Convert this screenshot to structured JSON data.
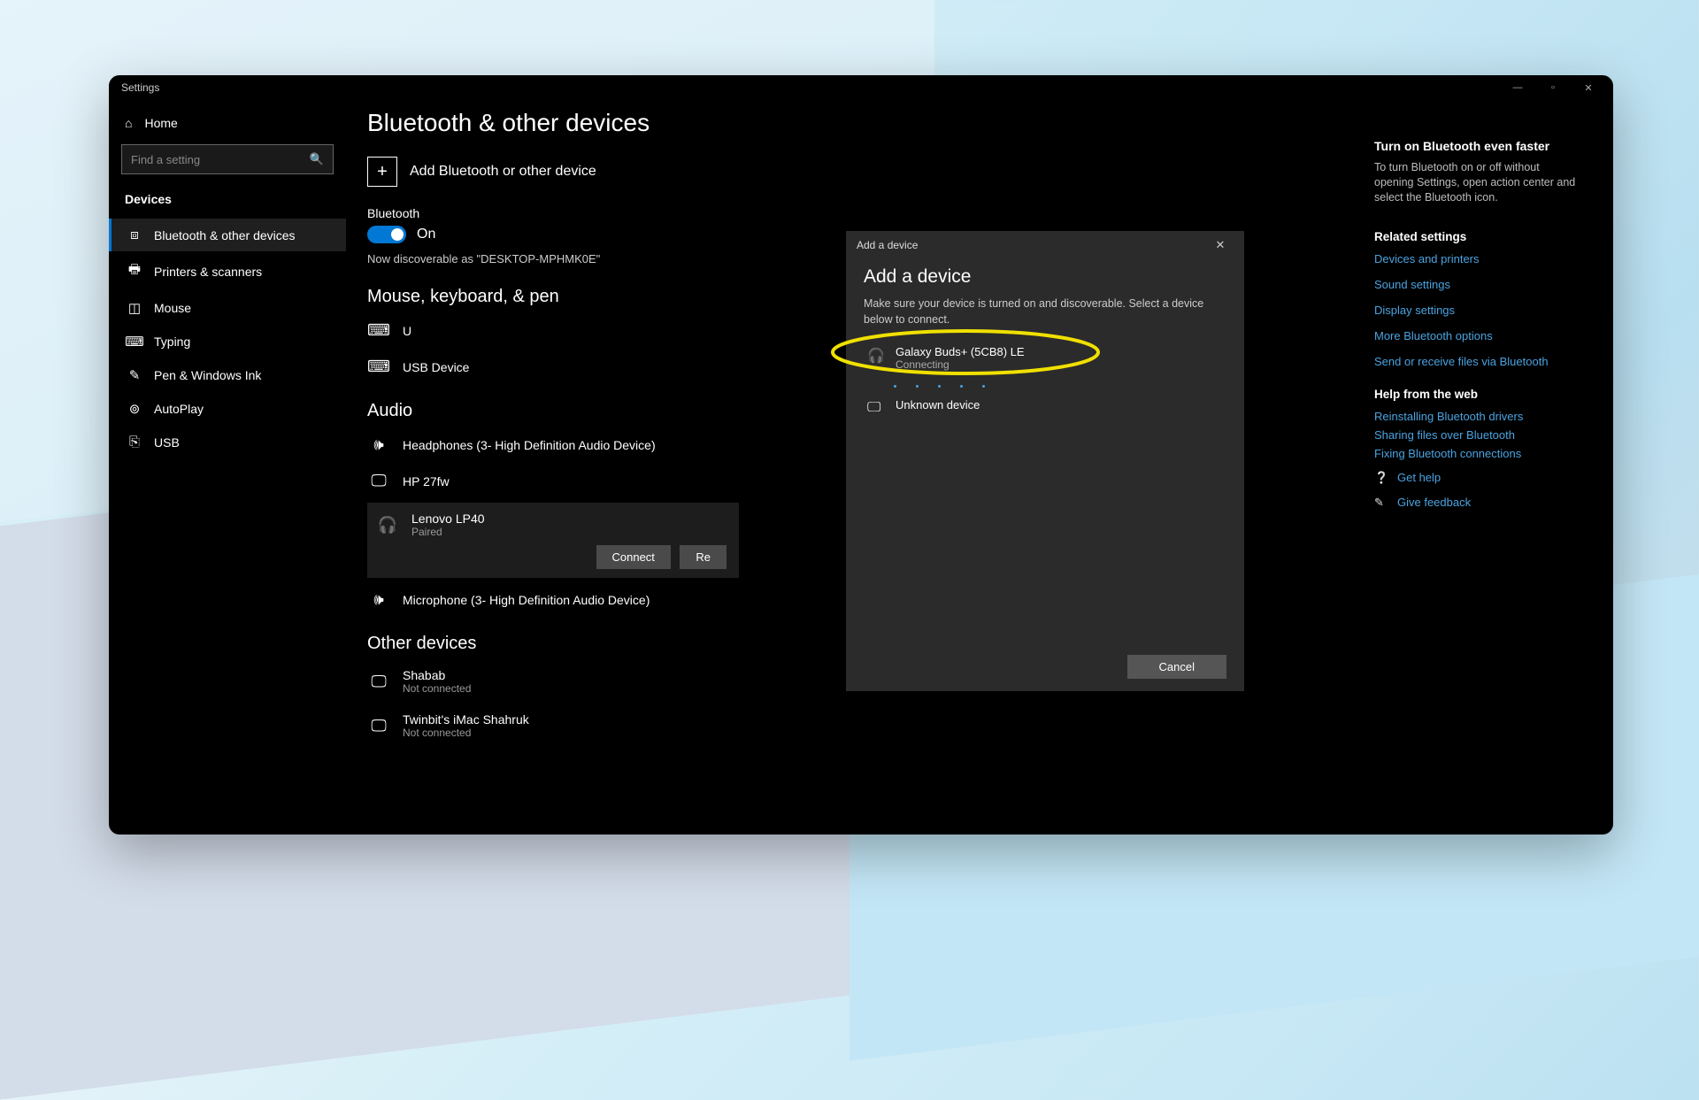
{
  "window": {
    "title": "Settings"
  },
  "winbtns": {
    "min": "—",
    "max": "▫",
    "close": "✕"
  },
  "sidebar": {
    "home": "Home",
    "search_placeholder": "Find a setting",
    "header": "Devices",
    "items": [
      {
        "label": "Bluetooth & other devices",
        "icon": "⧈"
      },
      {
        "label": "Printers & scanners",
        "icon": "🖶"
      },
      {
        "label": "Mouse",
        "icon": "◫"
      },
      {
        "label": "Typing",
        "icon": "⌨"
      },
      {
        "label": "Pen & Windows Ink",
        "icon": "✎"
      },
      {
        "label": "AutoPlay",
        "icon": "⊚"
      },
      {
        "label": "USB",
        "icon": "⎘"
      }
    ]
  },
  "main": {
    "heading": "Bluetooth & other devices",
    "add_device": "Add Bluetooth or other device",
    "bt_label": "Bluetooth",
    "bt_state": "On",
    "discoverable": "Now discoverable as \"DESKTOP-MPHMK0E\"",
    "sections": {
      "mkp": "Mouse, keyboard, & pen",
      "audio": "Audio",
      "other": "Other devices"
    },
    "mkp_items": [
      {
        "name": "U",
        "icon": "⌨"
      },
      {
        "name": "USB Device",
        "icon": "⌨"
      }
    ],
    "audio_items": [
      {
        "name": "Headphones (3- High Definition Audio Device)",
        "icon": "🕪"
      },
      {
        "name": "HP 27fw",
        "icon": "🖵"
      }
    ],
    "audio_card": {
      "name": "Lenovo LP40",
      "status": "Paired",
      "icon": "🎧",
      "connect": "Connect",
      "remove": "Re"
    },
    "audio_after": [
      {
        "name": "Microphone (3- High Definition Audio Device)",
        "icon": "🕪"
      }
    ],
    "other_items": [
      {
        "name": "Shabab",
        "status": "Not connected",
        "icon": "🖵"
      },
      {
        "name": "Twinbit's iMac Shahruk",
        "status": "Not connected",
        "icon": "🖵"
      }
    ]
  },
  "right": {
    "tip_h": "Turn on Bluetooth even faster",
    "tip_p": "To turn Bluetooth on or off without opening Settings, open action center and select the Bluetooth icon.",
    "related_h": "Related settings",
    "links": [
      "Devices and printers",
      "Sound settings",
      "Display settings",
      "More Bluetooth options",
      "Send or receive files via Bluetooth"
    ],
    "help_h": "Help from the web",
    "help_links": [
      "Reinstalling Bluetooth drivers",
      "Sharing files over Bluetooth",
      "Fixing Bluetooth connections"
    ],
    "get_help": "Get help",
    "feedback": "Give feedback"
  },
  "dialog": {
    "title": "Add a device",
    "heading": "Add a device",
    "instr": "Make sure your device is turned on and discoverable. Select a device below to connect.",
    "items": [
      {
        "name": "Galaxy Buds+ (5CB8) LE",
        "status": "Connecting",
        "icon": "🎧"
      },
      {
        "name": "Unknown device",
        "status": "",
        "icon": "🖵"
      }
    ],
    "cancel": "Cancel"
  }
}
